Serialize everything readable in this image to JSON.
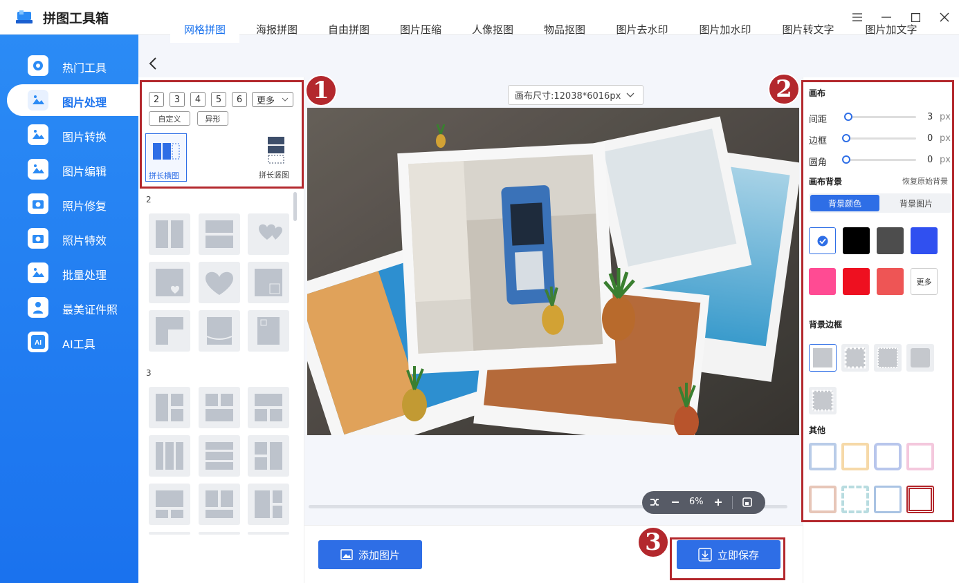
{
  "app": {
    "title": "拼图工具箱"
  },
  "sidebar": {
    "items": [
      {
        "label": "热门工具"
      },
      {
        "label": "图片处理"
      },
      {
        "label": "图片转换"
      },
      {
        "label": "图片编辑"
      },
      {
        "label": "照片修复"
      },
      {
        "label": "照片特效"
      },
      {
        "label": "批量处理"
      },
      {
        "label": "最美证件照"
      },
      {
        "label": "AI工具"
      }
    ]
  },
  "tabs": [
    "网格拼图",
    "海报拼图",
    "自由拼图",
    "图片压缩",
    "人像抠图",
    "物品抠图",
    "图片去水印",
    "图片加水印",
    "图片转文字",
    "图片加文字"
  ],
  "left": {
    "counts": [
      "2",
      "3",
      "4",
      "5",
      "6"
    ],
    "more": "更多",
    "custom": "自定义",
    "irregular": "异形",
    "long_horizontal": "拼长横图",
    "long_vertical": "拼长竖图",
    "section_2": "2",
    "section_3": "3"
  },
  "canvas": {
    "size_label": "画布尺寸:12038*6016px",
    "zoom": "6%"
  },
  "bottom": {
    "add_image": "添加图片",
    "save_now": "立即保存"
  },
  "right": {
    "canvas_title": "画布",
    "spacing": {
      "label": "间距",
      "value": "3",
      "unit": "px"
    },
    "border": {
      "label": "边框",
      "value": "0",
      "unit": "px"
    },
    "corner": {
      "label": "圆角",
      "value": "0",
      "unit": "px"
    },
    "bg_title": "画布背景",
    "restore": "恢复原始背景",
    "bg_color_tab": "背景颜色",
    "bg_image_tab": "背景图片",
    "swatches": [
      "#ffffff",
      "#000000",
      "#4d4d4d",
      "#3050f0",
      "#ff4b93",
      "#ee1020",
      "#ee5555"
    ],
    "more": "更多",
    "bg_border_title": "背景边框",
    "other_title": "其他"
  },
  "annotations": {
    "badge1": "1",
    "badge2": "2",
    "badge3": "3"
  }
}
